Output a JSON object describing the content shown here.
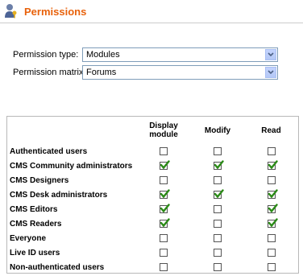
{
  "header": {
    "title": "Permissions",
    "icon": "user-key-icon"
  },
  "form": {
    "permission_type": {
      "label": "Permission type:",
      "value": "Modules"
    },
    "permission_matrix": {
      "label": "Permission matrix:",
      "value": "Forums"
    }
  },
  "table": {
    "columns": [
      "Display module",
      "Modify",
      "Read"
    ],
    "rows": [
      {
        "role": "Authenticated users",
        "values": [
          false,
          false,
          false
        ]
      },
      {
        "role": "CMS Community administrators",
        "values": [
          true,
          true,
          true
        ]
      },
      {
        "role": "CMS Designers",
        "values": [
          false,
          false,
          false
        ]
      },
      {
        "role": "CMS Desk administrators",
        "values": [
          true,
          true,
          true
        ]
      },
      {
        "role": "CMS Editors",
        "values": [
          true,
          false,
          true
        ]
      },
      {
        "role": "CMS Readers",
        "values": [
          true,
          false,
          true
        ]
      },
      {
        "role": "Everyone",
        "values": [
          false,
          false,
          false
        ]
      },
      {
        "role": "Live ID users",
        "values": [
          false,
          false,
          false
        ]
      },
      {
        "role": "Non-authenticated users",
        "values": [
          false,
          false,
          false
        ]
      }
    ]
  },
  "colors": {
    "title": "#e8620c",
    "check": "#2a8a16"
  }
}
